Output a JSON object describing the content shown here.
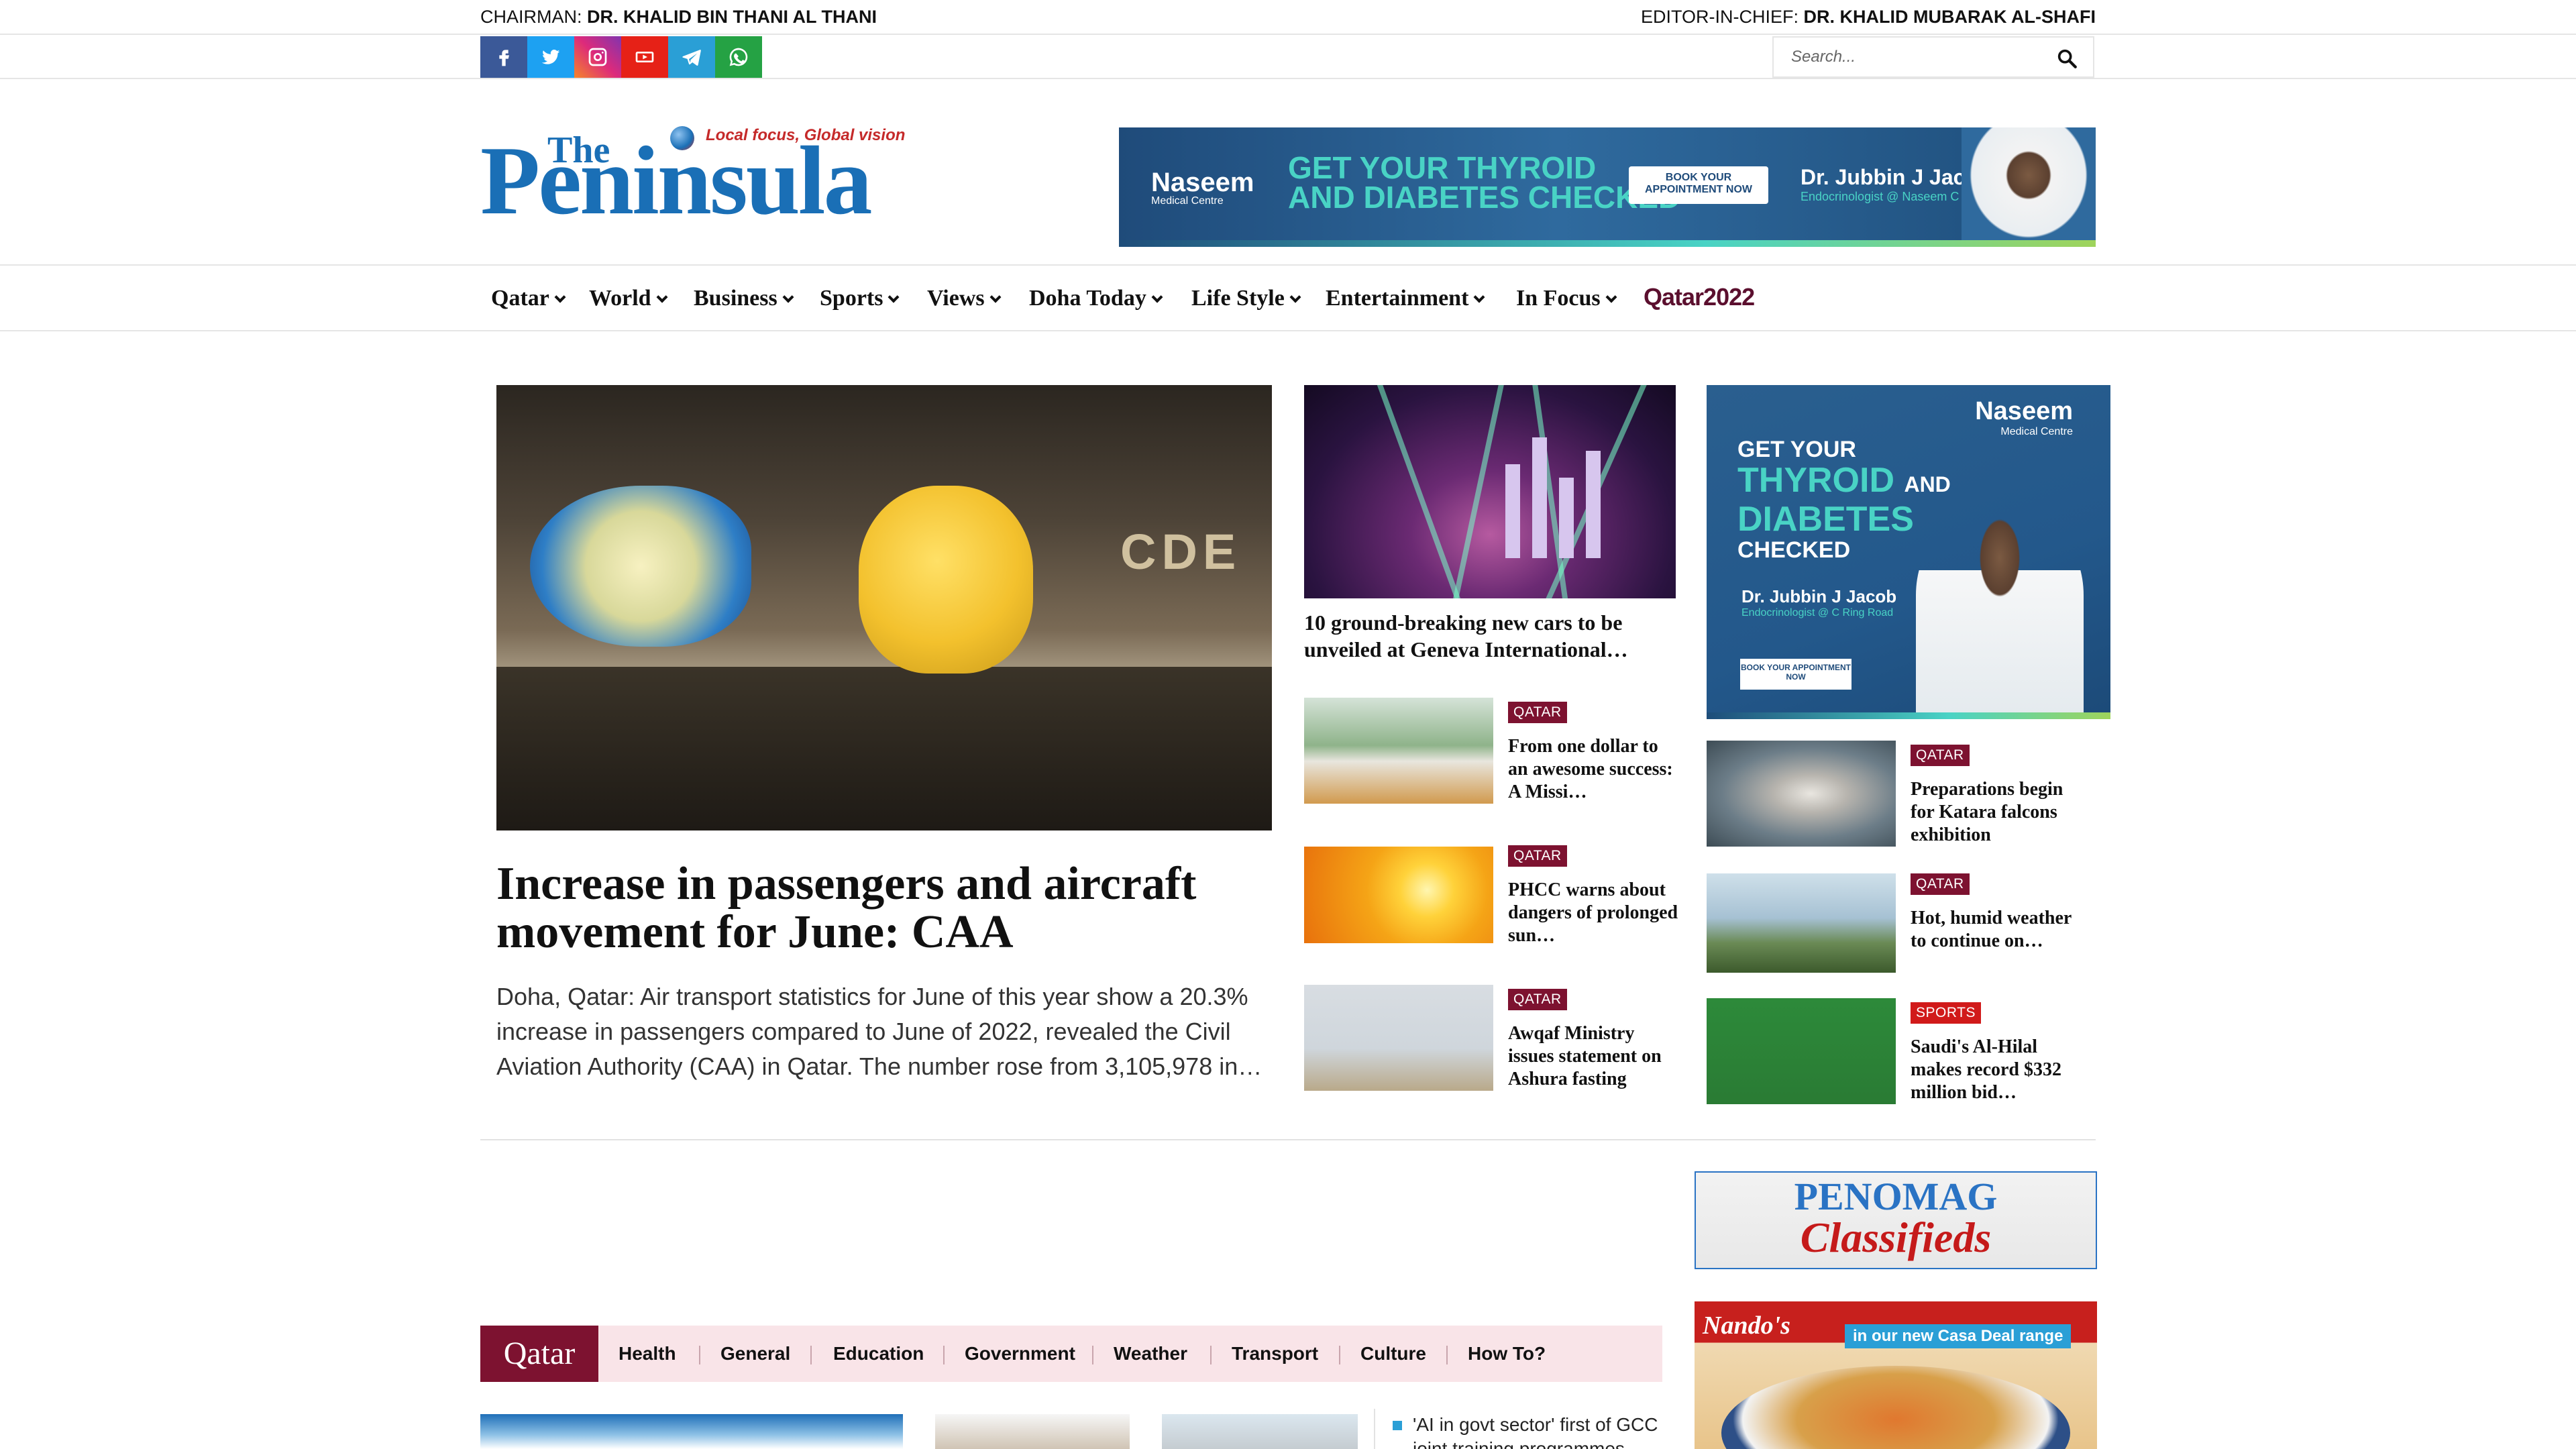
{
  "topbar": {
    "chairman_label": "CHAIRMAN:",
    "chairman_name": "DR. KHALID BIN THANI AL THANI",
    "editor_label": "EDITOR-IN-CHIEF:",
    "editor_name": "DR. KHALID MUBARAK AL-SHAFI"
  },
  "social": [
    {
      "name": "facebook",
      "color": "#3b5998",
      "icon": "facebook-icon"
    },
    {
      "name": "twitter",
      "color": "#1da1f2",
      "icon": "twitter-icon"
    },
    {
      "name": "instagram",
      "color": "#c13584",
      "icon": "instagram-icon"
    },
    {
      "name": "youtube",
      "color": "#e62117",
      "icon": "youtube-icon"
    },
    {
      "name": "telegram",
      "color": "#2a9fd6",
      "icon": "telegram-icon"
    },
    {
      "name": "whatsapp",
      "color": "#25a244",
      "icon": "whatsapp-icon"
    }
  ],
  "search": {
    "placeholder": "Search..."
  },
  "logo": {
    "the": "The",
    "name": "Peninsula",
    "tagline": "Local focus, Global vision"
  },
  "header_ad": {
    "brand": "Naseem",
    "brand_sub": "Medical Centre",
    "headline_1": "GET YOUR THYROID",
    "headline_2": "AND DIABETES CHECKED",
    "button": "BOOK YOUR APPOINTMENT NOW",
    "doctor": "Dr. Jubbin J Jacob",
    "doctor_title": "Endocrinologist @ Naseem C Ring"
  },
  "nav": {
    "items": [
      "Qatar",
      "World",
      "Business",
      "Sports",
      "Views",
      "Doha Today",
      "Life Style",
      "Entertainment",
      "In Focus"
    ],
    "qatar2022": "Qatar2022"
  },
  "hero": {
    "title": "Increase in passengers and aircraft movement for June: CAA",
    "description": "Doha, Qatar: Air transport statistics for June of this year show a 20.3% increase in passengers compared to June of 2022, revealed the Civil Aviation Authority (CAA) in Qatar. The number rose from 3,105,978 in…",
    "image_text": "CDE"
  },
  "featured": {
    "title": "10 ground-breaking new cars to be unveiled at Geneva International…"
  },
  "cards_mid": [
    {
      "category": "QATAR",
      "title": "From one dollar to an awesome success: A Missi…"
    },
    {
      "category": "QATAR",
      "title": "PHCC warns about dangers of prolonged sun…"
    },
    {
      "category": "QATAR",
      "title": "Awqaf Ministry issues statement on Ashura fasting"
    }
  ],
  "cards_right": [
    {
      "category": "QATAR",
      "title": "Preparations begin for Katara falcons exhibition"
    },
    {
      "category": "QATAR",
      "title": "Hot, humid weather to continue on…"
    },
    {
      "category": "SPORTS",
      "title": "Saudi's Al-Hilal makes record $332 million bid…"
    }
  ],
  "side_ad": {
    "brand": "Naseem",
    "brand_sub": "Medical Centre",
    "line1": "GET YOUR",
    "line2": "THYROID",
    "line2b": "AND",
    "line3": "DIABETES",
    "line4": "CHECKED",
    "doctor": "Dr. Jubbin J Jacob",
    "doctor_title": "Endocrinologist @ C Ring Road",
    "button": "BOOK YOUR APPOINTMENT NOW"
  },
  "penomag": {
    "line1": "PENOMAG",
    "line2": "Classifieds"
  },
  "nandos": {
    "logo": "Nando's",
    "tag": "in our new Casa Deal range"
  },
  "qatar_section": {
    "title": "Qatar",
    "tabs": [
      "Health",
      "General",
      "Education",
      "Government",
      "Weather",
      "Transport",
      "Culture",
      "How To?"
    ],
    "bullet": "'AI in govt sector' first of GCC joint training programmes"
  },
  "colors": {
    "accent": "#7d1230",
    "brand_blue": "#1a6fb6"
  }
}
